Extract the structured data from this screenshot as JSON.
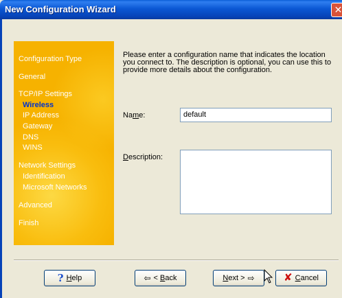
{
  "window": {
    "title": "New Configuration Wizard"
  },
  "sidebar": {
    "configuration_type": "Configuration Type",
    "general": "General",
    "tcpip_settings": "TCP/IP Settings",
    "wireless": "Wireless",
    "ip_address": "IP Address",
    "gateway": "Gateway",
    "dns": "DNS",
    "wins": "WINS",
    "network_settings": "Network Settings",
    "identification": "Identification",
    "microsoft_networks": "Microsoft Networks",
    "advanced": "Advanced",
    "finish": "Finish",
    "active_item": "Wireless",
    "accent_color": "#F6B200"
  },
  "main": {
    "intro_text": "Please enter a configuration name that indicates the location you connect to. The description is optional, you can use this to provide more details about the configuration.",
    "name_label_prefix": "Na",
    "name_label_mnemonic": "m",
    "name_label_suffix": "e:",
    "name_value": "default",
    "description_label_mnemonic": "D",
    "description_label_suffix": "escription:",
    "description_value": ""
  },
  "buttons": {
    "help_mnemonic": "H",
    "help_rest": "elp",
    "back_prefix": "< ",
    "back_mnemonic": "B",
    "back_rest": "ack",
    "next_mnemonic": "N",
    "next_rest": "ext >",
    "cancel_mnemonic": "C",
    "cancel_rest": "ancel"
  },
  "icons": {
    "help": "question-mark-icon",
    "back": "left-arrow-icon",
    "next": "right-arrow-icon",
    "cancel": "red-x-icon",
    "close": "close-icon",
    "pointer": "mouse-pointer-icon"
  }
}
